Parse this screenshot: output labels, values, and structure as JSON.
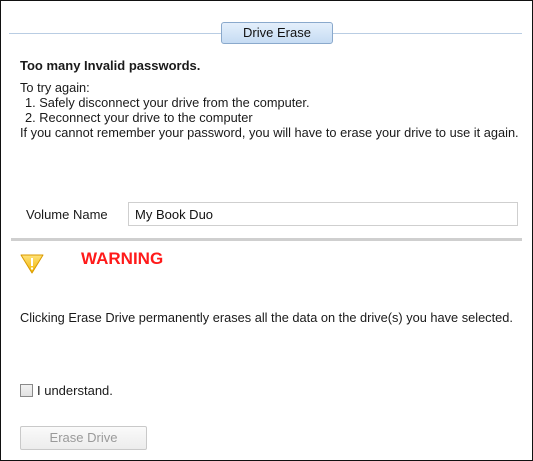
{
  "dialog": {
    "tab_label": "Drive Erase",
    "heading": "Too many Invalid passwords.",
    "instructions": {
      "intro": "To try again:",
      "step1": "1. Safely disconnect your drive from the computer.",
      "step2": "2. Reconnect your drive to the computer",
      "note": "If you cannot remember your password, you will have to erase your drive to use it again."
    },
    "volume": {
      "label": "Volume Name",
      "value": "My Book Duo"
    },
    "warning": {
      "icon": "warning-triangle-icon",
      "title": "WARNING",
      "text": "Clicking Erase Drive permanently erases all the data on the drive(s) you have selected.",
      "title_color": "#ff1a1a"
    },
    "acknowledge": {
      "label": "I understand.",
      "checked": false
    },
    "erase_button": {
      "label": "Erase Drive",
      "enabled": false
    }
  }
}
